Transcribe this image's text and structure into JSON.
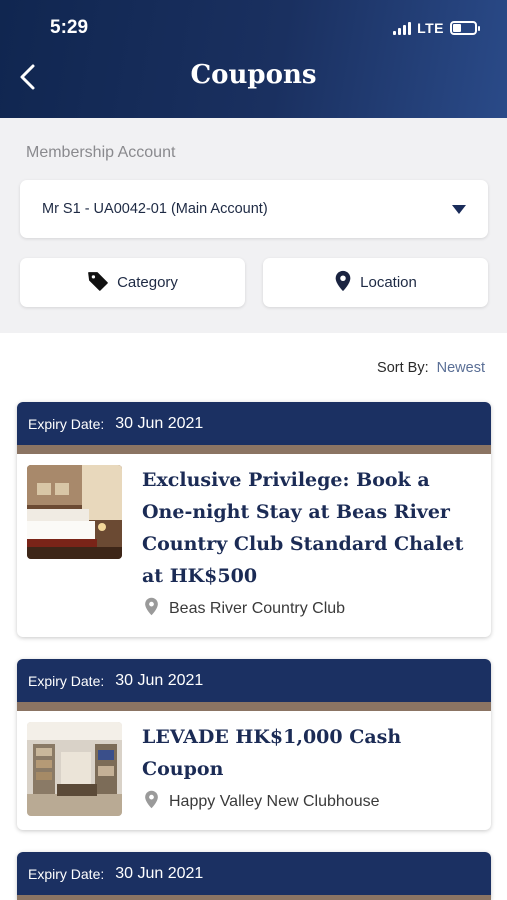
{
  "status_bar": {
    "time": "5:29",
    "network": "LTE"
  },
  "header": {
    "title": "Coupons"
  },
  "filters": {
    "membership_label": "Membership Account",
    "account_value": "Mr S1 - UA0042-01 (Main Account)",
    "category_label": "Category",
    "location_label": "Location"
  },
  "sort": {
    "label": "Sort By:",
    "value": "Newest"
  },
  "coupons": [
    {
      "expiry_label": "Expiry Date:",
      "expiry_date": "30 Jun 2021",
      "title": "Exclusive Privilege: Book a One-night Stay at Beas River Country Club Standard Chalet at HK$500",
      "location": "Beas River Country Club"
    },
    {
      "expiry_label": "Expiry Date:",
      "expiry_date": "30 Jun 2021",
      "title": "LEVADE HK$1,000 Cash Coupon",
      "location": "Happy Valley New Clubhouse"
    },
    {
      "expiry_label": "Expiry Date:",
      "expiry_date": "30 Jun 2021"
    }
  ],
  "colors": {
    "navy": "#1b3062",
    "band": "#8b7463",
    "panel": "#f1f1f3"
  },
  "icons": [
    "back-icon",
    "signal-icon",
    "battery-icon",
    "dropdown-caret-icon",
    "tag-icon",
    "location-pin-icon"
  ]
}
